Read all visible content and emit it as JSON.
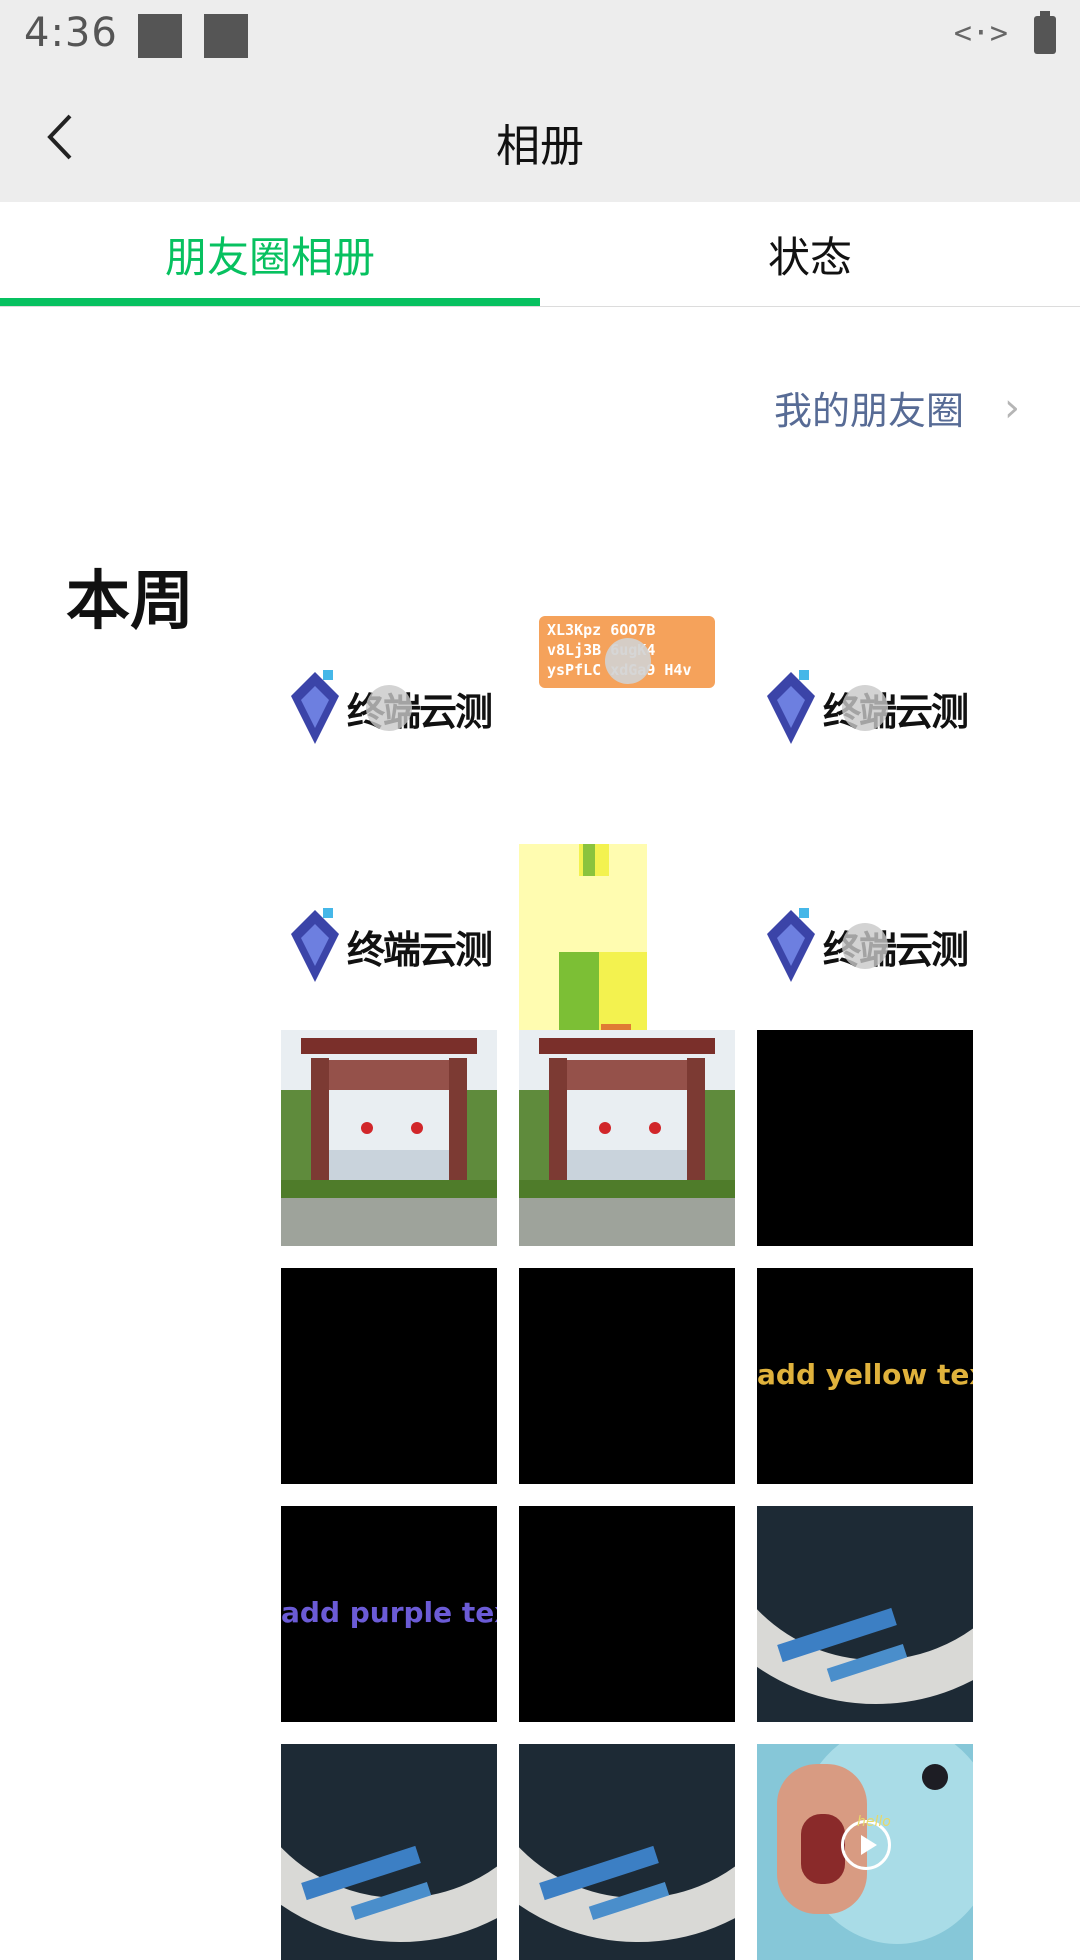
{
  "status_bar": {
    "time": "4:36",
    "network_icon": "<·>",
    "battery_icon": "battery-icon"
  },
  "header": {
    "title": "相册",
    "back_icon": "back-chevron-icon"
  },
  "tabs": [
    {
      "label": "朋友圈相册",
      "active": true
    },
    {
      "label": "状态",
      "active": false
    }
  ],
  "my_moments_link": "我的朋友圈",
  "section": {
    "title": "本周"
  },
  "colors": {
    "accent": "#07c160",
    "link": "#576b95",
    "header_bg": "#ededed"
  },
  "tiles": [
    {
      "type": "logo",
      "text": "终端云测"
    },
    {
      "type": "text-card",
      "text": "XL3Kpz 6OO7B v8Lj3B 6ugK4 ysPfLC xdGa9 H4v"
    },
    {
      "type": "logo",
      "text": "终端云测"
    },
    {
      "type": "logo",
      "text": "终端云测"
    },
    {
      "type": "pixel-image"
    },
    {
      "type": "logo",
      "text": "终端云测"
    },
    {
      "type": "photo-gate"
    },
    {
      "type": "photo-gate"
    },
    {
      "type": "black"
    },
    {
      "type": "black"
    },
    {
      "type": "black"
    },
    {
      "type": "text-video",
      "text": "add yellow text",
      "color": "#e0b23c"
    },
    {
      "type": "text-video",
      "text": "add purple text",
      "color": "#6b5bd6"
    },
    {
      "type": "black"
    },
    {
      "type": "fisheye"
    },
    {
      "type": "fisheye"
    },
    {
      "type": "fisheye"
    },
    {
      "type": "duck-video",
      "text": "hello"
    }
  ]
}
